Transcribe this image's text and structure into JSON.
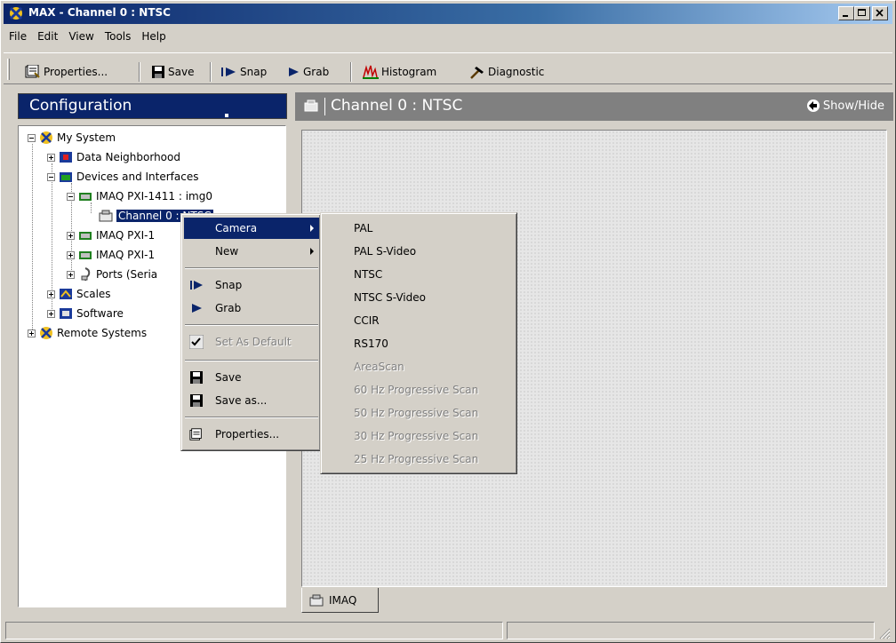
{
  "window": {
    "title": "MAX - Channel 0 : NTSC"
  },
  "menubar": [
    "File",
    "Edit",
    "View",
    "Tools",
    "Help"
  ],
  "toolbar": {
    "properties": "Properties...",
    "save": "Save",
    "snap": "Snap",
    "grab": "Grab",
    "histogram": "Histogram",
    "diagnostic": "Diagnostic"
  },
  "left_pane": {
    "header": "Configuration"
  },
  "tree": {
    "my_system": "My System",
    "data_neighborhood": "Data Neighborhood",
    "devices_interfaces": "Devices and Interfaces",
    "imaq_1411": "IMAQ PXI-1411 : img0",
    "channel": "Channel 0 : NTSC",
    "imaq_2": "IMAQ PXI-1",
    "imaq_3": "IMAQ PXI-1",
    "ports": "Ports (Seria",
    "scales": "Scales",
    "software": "Software",
    "remote_systems": "Remote Systems"
  },
  "right_pane": {
    "title": "Channel 0 : NTSC",
    "show_hide": "Show/Hide",
    "tab": "IMAQ"
  },
  "context_menu": {
    "camera": "Camera",
    "new": "New",
    "snap": "Snap",
    "grab": "Grab",
    "set_default": "Set As Default",
    "save": "Save",
    "save_as": "Save as...",
    "properties": "Properties..."
  },
  "camera_submenu": {
    "enabled": [
      "PAL",
      "PAL S-Video",
      "NTSC",
      "NTSC S-Video",
      "CCIR",
      "RS170"
    ],
    "disabled": [
      "AreaScan",
      "60 Hz Progressive Scan",
      "50 Hz Progressive Scan",
      "30 Hz Progressive Scan",
      "25 Hz Progressive Scan"
    ]
  }
}
